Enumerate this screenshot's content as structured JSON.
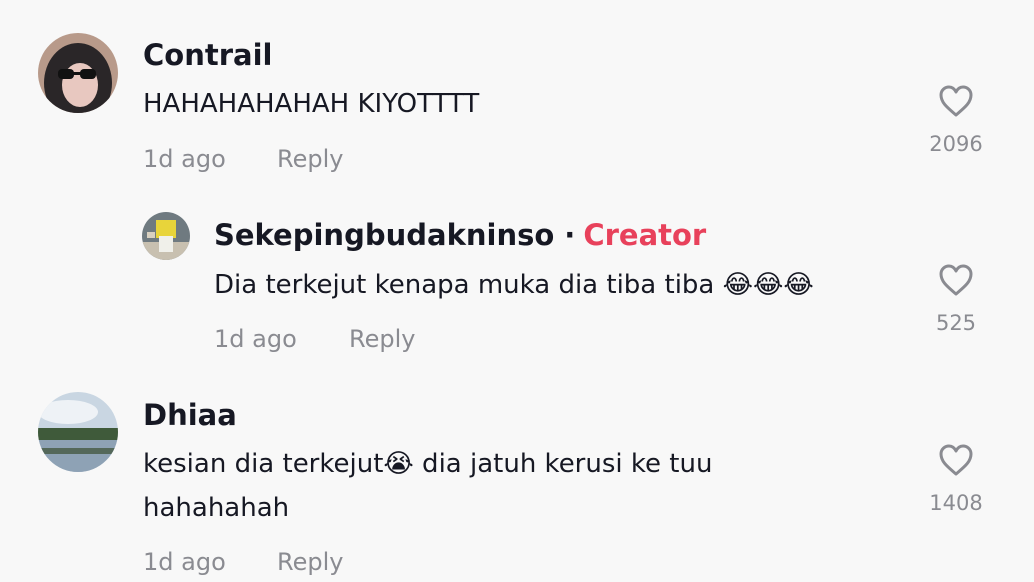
{
  "comments": [
    {
      "username": "Contrail",
      "text": "HAHAHAHAHAH KIYOTTTT",
      "time": "1d ago",
      "reply_label": "Reply",
      "likes": "2096",
      "like_icon": "heart-outline-icon"
    },
    {
      "username": "Sekepingbudakninso",
      "badge": "Creator",
      "text": "Dia terkejut kenapa muka dia tiba tiba",
      "emoji": "😂😂😂",
      "time": "1d ago",
      "reply_label": "Reply",
      "likes": "525",
      "like_icon": "heart-outline-icon"
    },
    {
      "username": "Dhiaa",
      "text_part1": "kesian dia terkejut",
      "emoji": "😭",
      "text_part2": " dia jatuh kerusi ke tuu",
      "text_line2": "hahahahah",
      "time": "1d ago",
      "reply_label": "Reply",
      "likes": "1408",
      "like_icon": "heart-outline-icon"
    }
  ],
  "colors": {
    "background": "#f8f8f8",
    "username": "#161823",
    "meta": "#8a8b91",
    "creator_badge": "#e8415b"
  }
}
